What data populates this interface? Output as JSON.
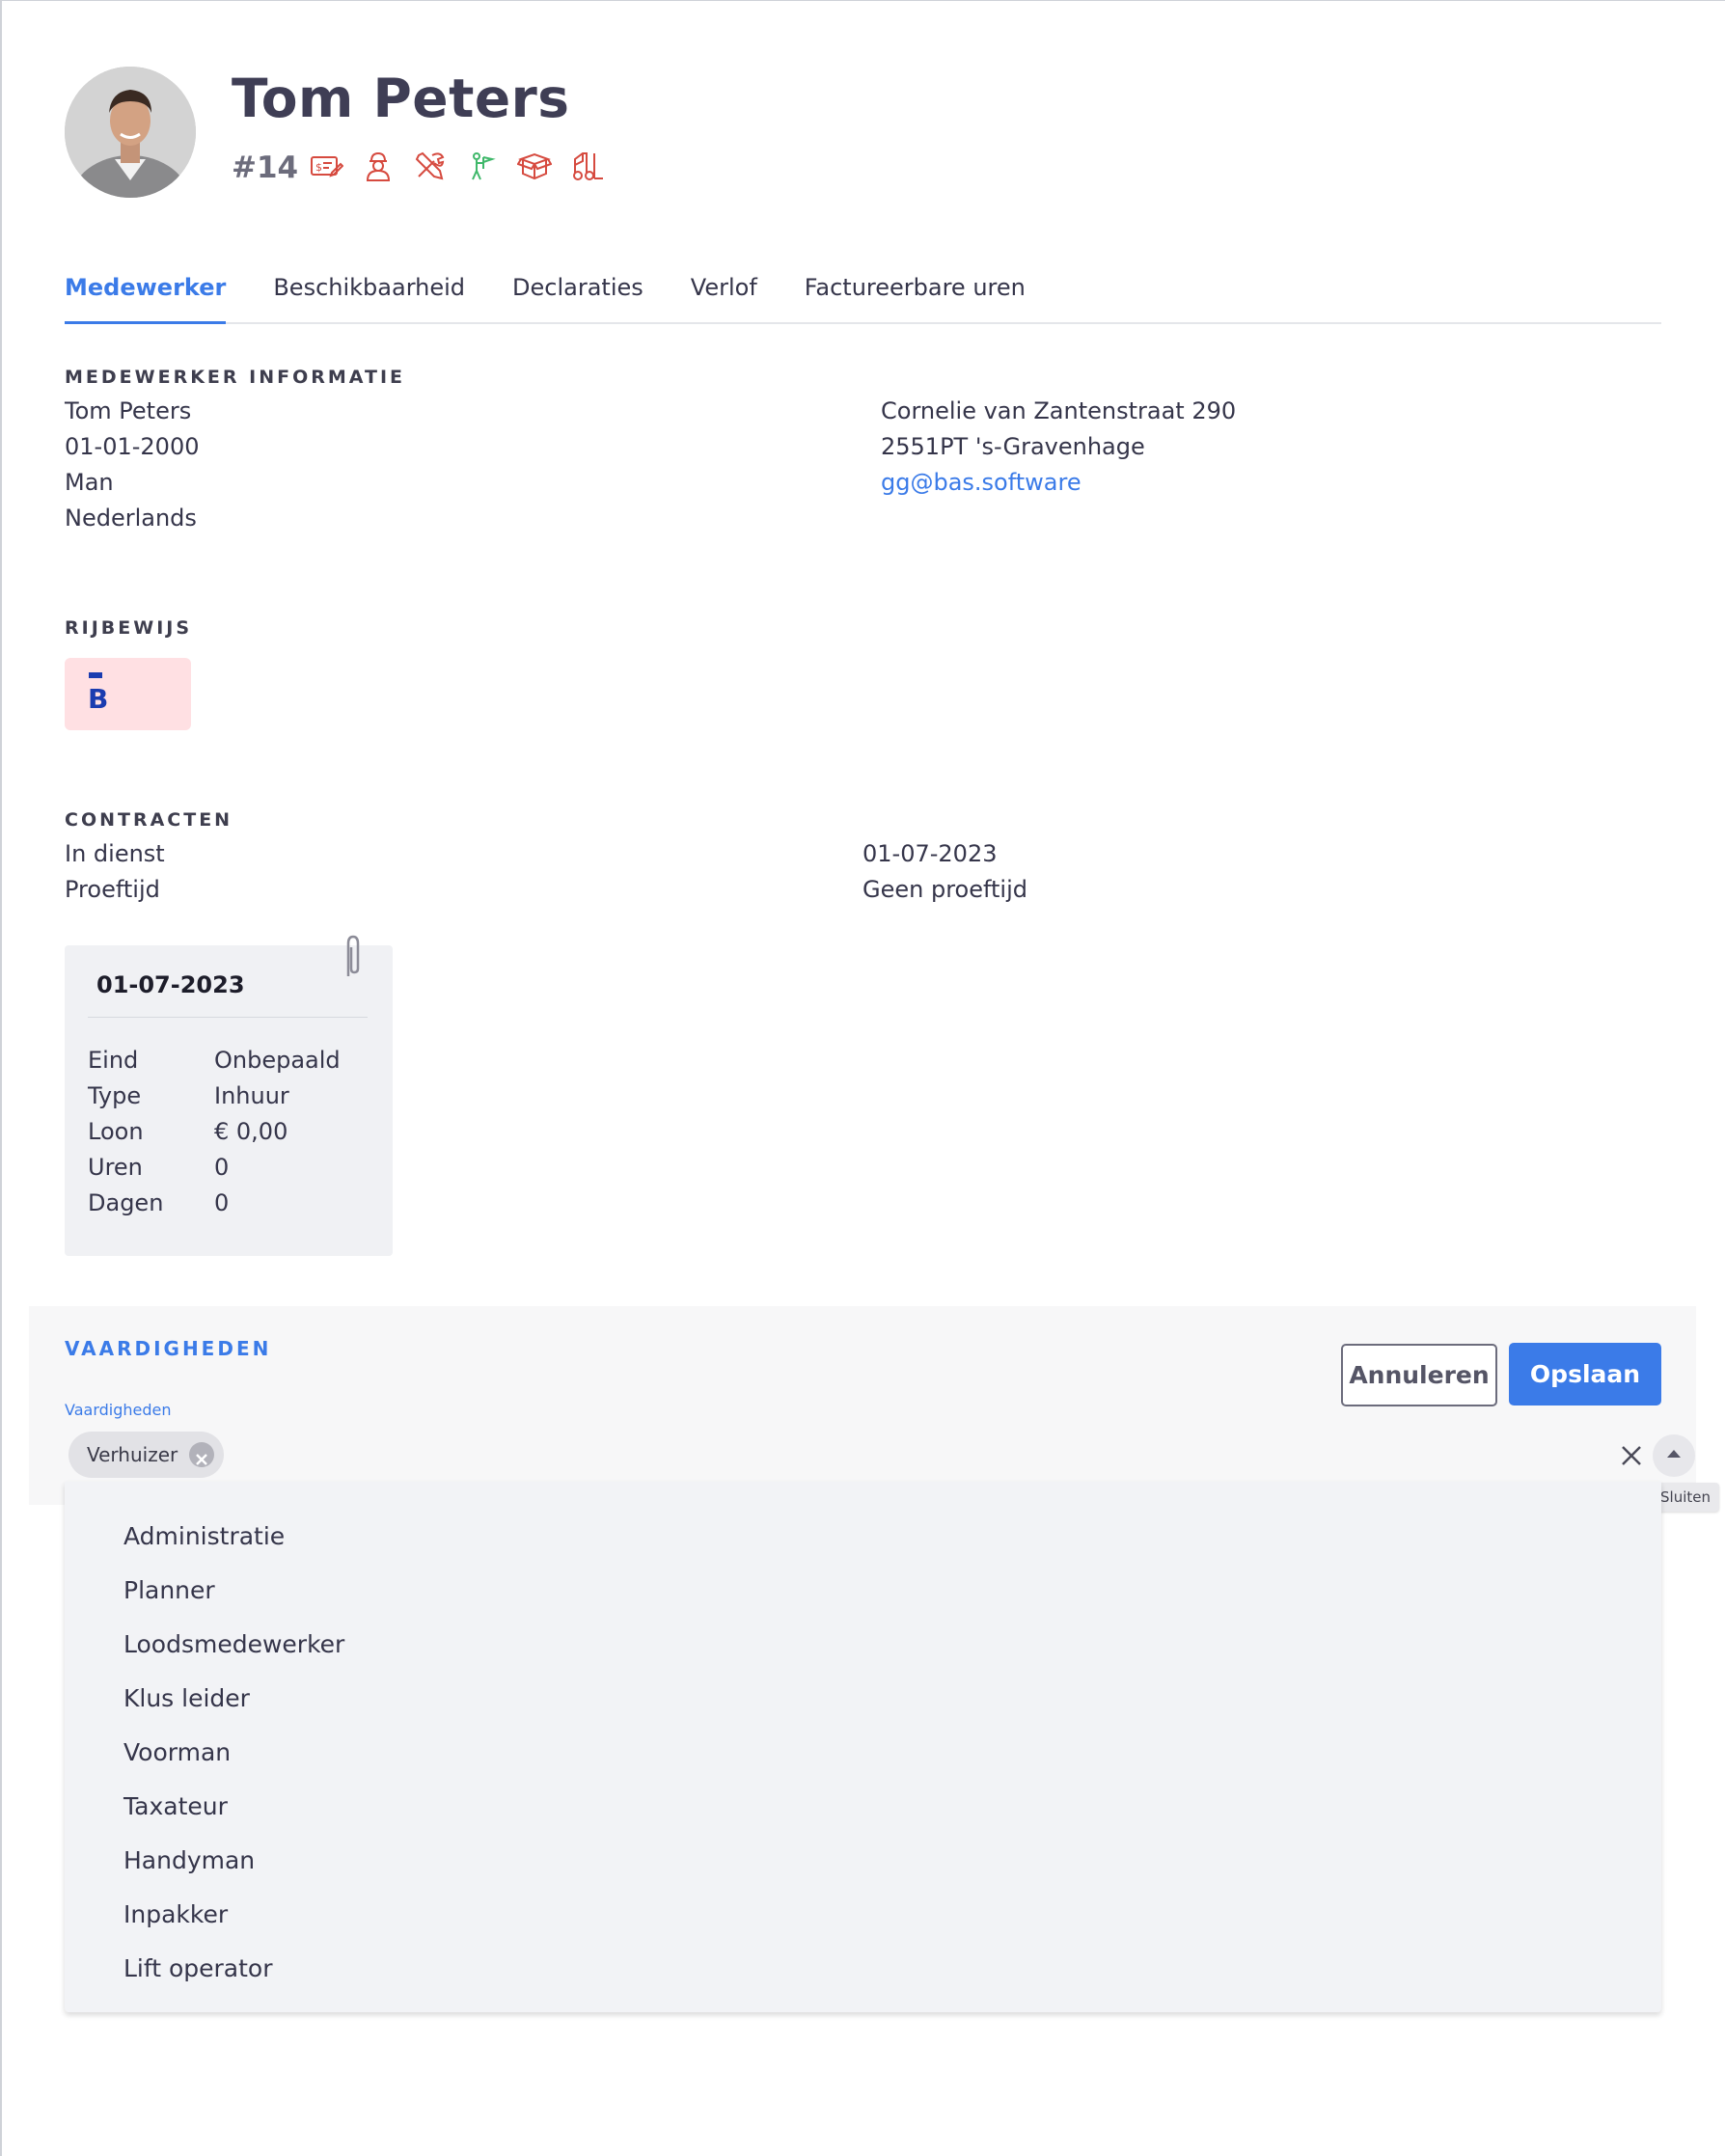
{
  "employee": {
    "name": "Tom Peters",
    "number": "#14",
    "role_icons": [
      {
        "icon": "invoice-pen-icon",
        "color": "#d64a3f"
      },
      {
        "icon": "worker-icon",
        "color": "#d64a3f"
      },
      {
        "icon": "tools-icon",
        "color": "#d64a3f"
      },
      {
        "icon": "flag-person-icon",
        "color": "#3fb86a"
      },
      {
        "icon": "box-icon",
        "color": "#d64a3f"
      },
      {
        "icon": "forklift-icon",
        "color": "#d64a3f"
      }
    ]
  },
  "tabs": [
    "Medewerker",
    "Beschikbaarheid",
    "Declaraties",
    "Verlof",
    "Factureerbare uren"
  ],
  "active_tab": "Medewerker",
  "info": {
    "title": "MEDEWERKER INFORMATIE",
    "name": "Tom Peters",
    "birthdate": "01-01-2000",
    "gender": "Man",
    "nationality": "Nederlands",
    "street": "Cornelie van Zantenstraat 290",
    "postal_city": "2551PT 's-Gravenhage",
    "email": "gg@bas.software"
  },
  "license": {
    "title": "RIJBEWIJS",
    "category": "B",
    "badge_color": "#ffe0e3"
  },
  "contracts": {
    "title": "CONTRACTEN",
    "in_service_label": "In dienst",
    "in_service_value": "01-07-2023",
    "probation_label": "Proeftijd",
    "probation_value": "Geen proeftijd",
    "card": {
      "date": "01-07-2023",
      "rows": [
        {
          "label": "Eind",
          "value": "Onbepaald"
        },
        {
          "label": "Type",
          "value": "Inhuur"
        },
        {
          "label": "Loon",
          "value": "€ 0,00"
        },
        {
          "label": "Uren",
          "value": "0"
        },
        {
          "label": "Dagen",
          "value": "0"
        }
      ]
    }
  },
  "skills": {
    "title": "VAARDIGHEDEN",
    "field_label": "Vaardigheden",
    "selected": [
      "Verhuizer"
    ],
    "cancel_label": "Annuleren",
    "save_label": "Opslaan",
    "tooltip": "Sluiten",
    "options": [
      "Administratie",
      "Planner",
      "Loodsmedewerker",
      "Klus leider",
      "Voorman",
      "Taxateur",
      "Handyman",
      "Inpakker",
      "Lift operator"
    ]
  },
  "colors": {
    "accent": "#3b7be8",
    "title_text": "#3f3e55"
  }
}
